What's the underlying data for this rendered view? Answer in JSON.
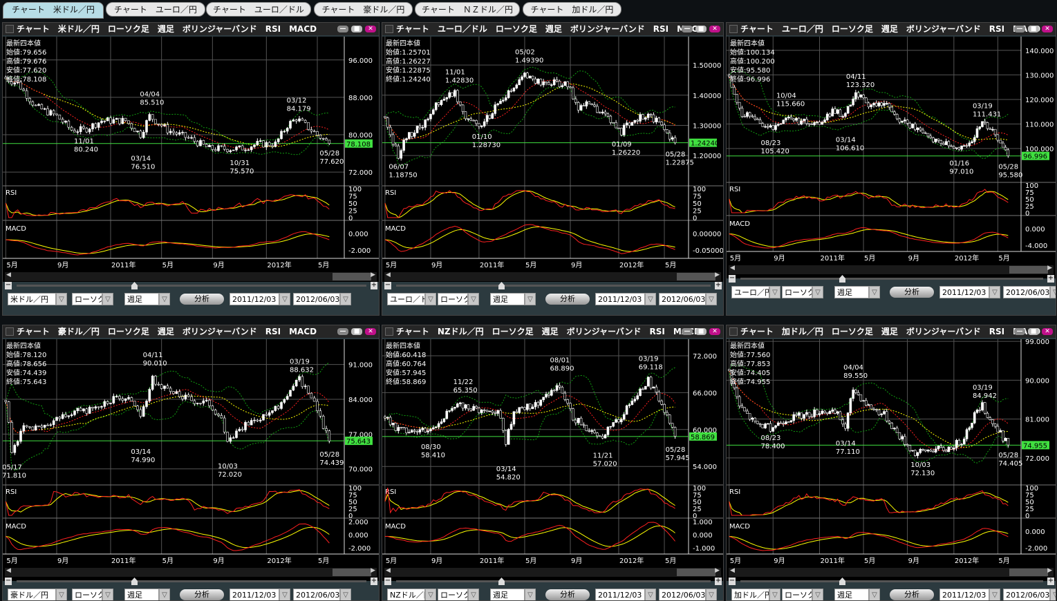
{
  "tabs": [
    "チャート　米ドル／円",
    "チャート　ユーロ／円",
    "チャート　ユーロ／ドル",
    "チャート　豪ドル／円",
    "チャート　ＮＺドル／円",
    "チャート　加ドル／円"
  ],
  "active_tab": 0,
  "common": {
    "ohlc_title": "最新四本値",
    "open_label": "始値:",
    "high_label": "高値:",
    "low_label": "安値:",
    "close_label": "終値:",
    "rsi_label": "RSI",
    "macd_label": "MACD",
    "rsi_ticks": [
      "100",
      "75",
      "50",
      "25",
      "0"
    ],
    "x_labels": [
      {
        "text": "5月",
        "week": 0
      },
      {
        "text": "9月",
        "week": 17
      },
      {
        "text": "2011年",
        "week": 35
      },
      {
        "text": "5月",
        "week": 52
      },
      {
        "text": "9月",
        "week": 69
      },
      {
        "text": "2012年",
        "week": 87
      },
      {
        "text": "5月",
        "week": 104
      }
    ],
    "chart_type": "ローソク足",
    "period": "週足",
    "analyze_label": "分析",
    "date_from": "2011/12/03",
    "date_to": "2012/06/03",
    "dropdown_glyph": "▽",
    "minimize": "—",
    "maximize": "■",
    "close": "✕",
    "minus": "−",
    "plus": "+"
  },
  "colors": {
    "candle": "#ffffff",
    "ma_red": "#ff2020",
    "ma_yellow": "#ffff00",
    "band_green": "#10a010",
    "price_line": "#40e040",
    "tag": "#40e040"
  },
  "panels": [
    {
      "title": "チャート　米ドル／円　ローソク足　週足　ボリンジャーバンド　RSI　MACD",
      "pair": "米ドル／円",
      "open": "79.656",
      "high": "79.676",
      "low": "77.620",
      "close": "78.108",
      "last": 78.108,
      "ylim": [
        69.2,
        101
      ],
      "yticks": [
        {
          "v": 96,
          "t": "96.000"
        },
        {
          "v": 88,
          "t": "88.000"
        },
        {
          "v": 80,
          "t": "80.000"
        },
        {
          "v": 72,
          "t": "72.000"
        }
      ],
      "macd_ticks": [
        "0.000",
        "-2.000"
      ],
      "waypoints": [
        [
          0,
          92
        ],
        [
          4,
          91
        ],
        [
          10,
          86
        ],
        [
          17,
          84
        ],
        [
          22,
          81
        ],
        [
          26,
          81
        ],
        [
          32,
          83
        ],
        [
          40,
          83
        ],
        [
          45,
          80
        ],
        [
          48,
          84
        ],
        [
          54,
          81
        ],
        [
          62,
          79
        ],
        [
          68,
          77
        ],
        [
          74,
          77
        ],
        [
          78,
          77
        ],
        [
          84,
          78
        ],
        [
          90,
          78
        ],
        [
          94,
          82
        ],
        [
          97,
          83.5
        ],
        [
          100,
          82
        ],
        [
          104,
          80
        ],
        [
          108,
          78.1
        ]
      ],
      "annotations": [
        {
          "date": "11/01",
          "value": "80.240",
          "week": 26,
          "pos": "below"
        },
        {
          "date": "04/04",
          "value": "85.510",
          "week": 48,
          "pos": "above"
        },
        {
          "date": "03/14",
          "value": "76.510",
          "week": 45,
          "pos": "below"
        },
        {
          "date": "10/31",
          "value": "75.570",
          "week": 78,
          "pos": "below"
        },
        {
          "date": "03/12",
          "value": "84.179",
          "week": 97,
          "pos": "above"
        },
        {
          "date": "05/28",
          "value": "77.620",
          "week": 108,
          "pos": "below"
        }
      ]
    },
    {
      "title": "チャート　ユーロ／ドル　ローソク足　週足　ボリンジャーバンド　RSI　MACD",
      "pair": "ユーロ／ドル",
      "open": "1.25701",
      "high": "1.26227",
      "low": "1.22875",
      "close": "1.24240",
      "last": 1.2424,
      "ylim": [
        1.102,
        1.594
      ],
      "yticks": [
        {
          "v": 1.5,
          "t": "1.50000"
        },
        {
          "v": 1.4,
          "t": "1.40000"
        },
        {
          "v": 1.3,
          "t": "1.30000"
        },
        {
          "v": 1.2,
          "t": "1.20000"
        }
      ],
      "macd_ticks": [
        "0.00000",
        "-0.05000"
      ],
      "waypoints": [
        [
          0,
          1.32
        ],
        [
          5,
          1.2
        ],
        [
          8,
          1.26
        ],
        [
          14,
          1.3
        ],
        [
          20,
          1.38
        ],
        [
          26,
          1.41
        ],
        [
          30,
          1.33
        ],
        [
          36,
          1.3
        ],
        [
          42,
          1.37
        ],
        [
          48,
          1.42
        ],
        [
          52,
          1.47
        ],
        [
          58,
          1.44
        ],
        [
          64,
          1.44
        ],
        [
          68,
          1.43
        ],
        [
          72,
          1.36
        ],
        [
          76,
          1.37
        ],
        [
          82,
          1.33
        ],
        [
          88,
          1.28
        ],
        [
          92,
          1.32
        ],
        [
          98,
          1.33
        ],
        [
          102,
          1.31
        ],
        [
          108,
          1.2424
        ]
      ],
      "annotations": [
        {
          "date": "06/07",
          "value": "1.18750",
          "week": 5,
          "pos": "below"
        },
        {
          "date": "11/01",
          "value": "1.42830",
          "week": 26,
          "pos": "above"
        },
        {
          "date": "01/10",
          "value": "1.28730",
          "week": 36,
          "pos": "below"
        },
        {
          "date": "05/02",
          "value": "1.49390",
          "week": 52,
          "pos": "above"
        },
        {
          "date": "01/09",
          "value": "1.26220",
          "week": 88,
          "pos": "below"
        },
        {
          "date": "05/28",
          "value": "1.22875",
          "week": 108,
          "pos": "below"
        }
      ]
    },
    {
      "title": "チャート　ユーロ／円　ローソク足　週足　ボリンジャーバンド　RSI　MACD",
      "pair": "ユーロ／円",
      "open": "100.134",
      "high": "100.200",
      "low": "95.580",
      "close": "96.996",
      "last": 96.996,
      "ylim": [
        86.5,
        145.6
      ],
      "yticks": [
        {
          "v": 140,
          "t": "140.000"
        },
        {
          "v": 130,
          "t": "130.000"
        },
        {
          "v": 120,
          "t": "120.000"
        },
        {
          "v": 110,
          "t": "110.000"
        },
        {
          "v": 100,
          "t": "100.000"
        }
      ],
      "macd_ticks": [
        "0.000",
        "-4.000"
      ],
      "waypoints": [
        [
          0,
          128
        ],
        [
          4,
          115
        ],
        [
          10,
          112
        ],
        [
          16,
          108
        ],
        [
          22,
          113
        ],
        [
          28,
          111
        ],
        [
          34,
          110
        ],
        [
          40,
          115
        ],
        [
          45,
          114
        ],
        [
          49,
          122
        ],
        [
          54,
          118
        ],
        [
          60,
          118
        ],
        [
          66,
          112
        ],
        [
          72,
          108
        ],
        [
          78,
          104
        ],
        [
          84,
          102
        ],
        [
          89,
          99
        ],
        [
          94,
          104
        ],
        [
          98,
          110
        ],
        [
          102,
          107
        ],
        [
          108,
          97
        ]
      ],
      "annotations": [
        {
          "date": "10/04",
          "value": "115.660",
          "week": 22,
          "pos": "above"
        },
        {
          "date": "08/23",
          "value": "105.420",
          "week": 16,
          "pos": "below"
        },
        {
          "date": "04/11",
          "value": "123.320",
          "week": 49,
          "pos": "above"
        },
        {
          "date": "03/14",
          "value": "106.610",
          "week": 45,
          "pos": "below"
        },
        {
          "date": "03/19",
          "value": "111.431",
          "week": 98,
          "pos": "above"
        },
        {
          "date": "01/16",
          "value": "97.010",
          "week": 89,
          "pos": "below"
        },
        {
          "date": "05/28",
          "value": "95.580",
          "week": 108,
          "pos": "below"
        }
      ]
    },
    {
      "title": "チャート　豪ドル／円　ローソク足　週足　ボリンジャーバンド　RSI　MACD",
      "pair": "豪ドル／円",
      "open": "78.120",
      "high": "78.656",
      "low": "74.439",
      "close": "75.643",
      "last": 75.643,
      "ylim": [
        66.9,
        96.1
      ],
      "yticks": [
        {
          "v": 91,
          "t": "91.000"
        },
        {
          "v": 84,
          "t": "84.000"
        },
        {
          "v": 77,
          "t": "77.000"
        },
        {
          "v": 70,
          "t": "70.000"
        }
      ],
      "macd_ticks": [
        "2.000",
        "0.000",
        "-2.000"
      ],
      "waypoints": [
        [
          0,
          84
        ],
        [
          2,
          74
        ],
        [
          6,
          78
        ],
        [
          12,
          78
        ],
        [
          20,
          81
        ],
        [
          28,
          82
        ],
        [
          36,
          84
        ],
        [
          42,
          84
        ],
        [
          45,
          80
        ],
        [
          49,
          88
        ],
        [
          54,
          86
        ],
        [
          62,
          84
        ],
        [
          68,
          83
        ],
        [
          72,
          80
        ],
        [
          74,
          76
        ],
        [
          78,
          78
        ],
        [
          84,
          80
        ],
        [
          90,
          82
        ],
        [
          95,
          86
        ],
        [
          98,
          88
        ],
        [
          102,
          85
        ],
        [
          108,
          75.6
        ]
      ],
      "annotations": [
        {
          "date": "05/17",
          "value": "71.810",
          "week": 2,
          "pos": "below"
        },
        {
          "date": "04/11",
          "value": "90.010",
          "week": 49,
          "pos": "above"
        },
        {
          "date": "03/14",
          "value": "74.990",
          "week": 45,
          "pos": "below"
        },
        {
          "date": "10/03",
          "value": "72.020",
          "week": 74,
          "pos": "below"
        },
        {
          "date": "03/19",
          "value": "88.632",
          "week": 98,
          "pos": "above"
        },
        {
          "date": "05/28",
          "value": "74.439",
          "week": 108,
          "pos": "below"
        }
      ]
    },
    {
      "title": "チャート　NZドル／円　ローソク足　週足　ボリンジャーバンド　RSI　MACD",
      "pair": "NZドル／円",
      "open": "60.418",
      "high": "60.764",
      "low": "57.945",
      "close": "58.869",
      "last": 58.869,
      "ylim": [
        51.1,
        74.7
      ],
      "yticks": [
        {
          "v": 72,
          "t": "72.000"
        },
        {
          "v": 66,
          "t": "66.000"
        },
        {
          "v": 60,
          "t": "60.000"
        },
        {
          "v": 54,
          "t": "54.000"
        }
      ],
      "macd_ticks": [
        "1.000",
        "0.000",
        "-1.000"
      ],
      "waypoints": [
        [
          0,
          62
        ],
        [
          4,
          60
        ],
        [
          10,
          60
        ],
        [
          17,
          60
        ],
        [
          24,
          63
        ],
        [
          29,
          64
        ],
        [
          36,
          63
        ],
        [
          42,
          63
        ],
        [
          45,
          58
        ],
        [
          48,
          63
        ],
        [
          56,
          64
        ],
        [
          62,
          66
        ],
        [
          65,
          67
        ],
        [
          70,
          62
        ],
        [
          76,
          60
        ],
        [
          81,
          59
        ],
        [
          88,
          62
        ],
        [
          94,
          66
        ],
        [
          98,
          68
        ],
        [
          102,
          65
        ],
        [
          108,
          58.9
        ]
      ],
      "annotations": [
        {
          "date": "08/30",
          "value": "58.410",
          "week": 17,
          "pos": "below"
        },
        {
          "date": "11/22",
          "value": "65.350",
          "week": 29,
          "pos": "above"
        },
        {
          "date": "03/14",
          "value": "54.820",
          "week": 45,
          "pos": "below"
        },
        {
          "date": "08/01",
          "value": "68.890",
          "week": 65,
          "pos": "above"
        },
        {
          "date": "11/21",
          "value": "57.020",
          "week": 81,
          "pos": "below"
        },
        {
          "date": "03/19",
          "value": "69.118",
          "week": 98,
          "pos": "above"
        },
        {
          "date": "05/28",
          "value": "57.945",
          "week": 108,
          "pos": "below"
        }
      ]
    },
    {
      "title": "チャート　加ドル／円　ローソク足　週足　ボリンジャーバンド　RSI　MACD",
      "pair": "加ドル／円",
      "open": "77.560",
      "high": "77.853",
      "low": "74.405",
      "close": "74.955",
      "last": 74.955,
      "ylim": [
        65.9,
        99.5
      ],
      "yticks": [
        {
          "v": 99,
          "t": "99.000"
        },
        {
          "v": 90,
          "t": "90.000"
        },
        {
          "v": 81,
          "t": "81.000"
        },
        {
          "v": 72,
          "t": "72.000"
        }
      ],
      "macd_ticks": [
        "0.000",
        "-2.000"
      ],
      "waypoints": [
        [
          0,
          92
        ],
        [
          4,
          84
        ],
        [
          10,
          80
        ],
        [
          16,
          79
        ],
        [
          22,
          81
        ],
        [
          30,
          82
        ],
        [
          36,
          83
        ],
        [
          42,
          82
        ],
        [
          45,
          79
        ],
        [
          48,
          88
        ],
        [
          54,
          84
        ],
        [
          60,
          82
        ],
        [
          66,
          77
        ],
        [
          72,
          73
        ],
        [
          78,
          74
        ],
        [
          84,
          74
        ],
        [
          90,
          76
        ],
        [
          95,
          82
        ],
        [
          98,
          84
        ],
        [
          102,
          80
        ],
        [
          108,
          75
        ]
      ],
      "annotations": [
        {
          "date": "08/23",
          "value": "78.400",
          "week": 16,
          "pos": "below"
        },
        {
          "date": "04/04",
          "value": "89.550",
          "week": 48,
          "pos": "above"
        },
        {
          "date": "03/14",
          "value": "77.110",
          "week": 45,
          "pos": "below"
        },
        {
          "date": "10/03",
          "value": "72.130",
          "week": 74,
          "pos": "below"
        },
        {
          "date": "03/19",
          "value": "84.942",
          "week": 98,
          "pos": "above"
        },
        {
          "date": "05/28",
          "value": "74.405",
          "week": 108,
          "pos": "below"
        }
      ]
    }
  ]
}
